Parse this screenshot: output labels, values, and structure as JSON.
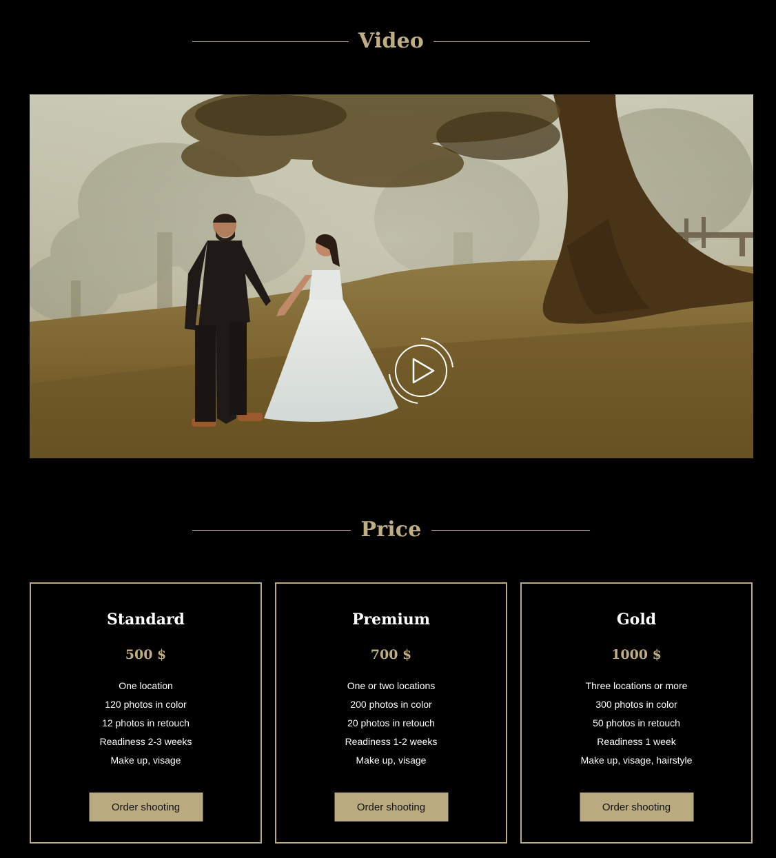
{
  "video_section": {
    "title": "Video",
    "accent_color": "#bfae82",
    "thumbnail": "wedding couple holding hands under misty trees",
    "play_icon": "play-circle-icon"
  },
  "price_section": {
    "title": "Price",
    "plans": [
      {
        "name": "Standard",
        "price": "500 $",
        "features": [
          "One location",
          "120 photos in color",
          "12 photos in retouch",
          "Readiness 2-3 weeks",
          "Make up, visage"
        ],
        "button": "Order shooting"
      },
      {
        "name": "Premium",
        "price": "700 $",
        "features": [
          "One or two locations",
          "200 photos in color",
          "20 photos in retouch",
          "Readiness 1-2 weeks",
          "Make up, visage"
        ],
        "button": "Order shooting"
      },
      {
        "name": "Gold",
        "price": "1000 $",
        "features": [
          "Three locations or more",
          "300 photos in color",
          "50 photos in retouch",
          "Readiness 1 week",
          "Make up, visage, hairstyle"
        ],
        "button": "Order shooting"
      }
    ]
  }
}
